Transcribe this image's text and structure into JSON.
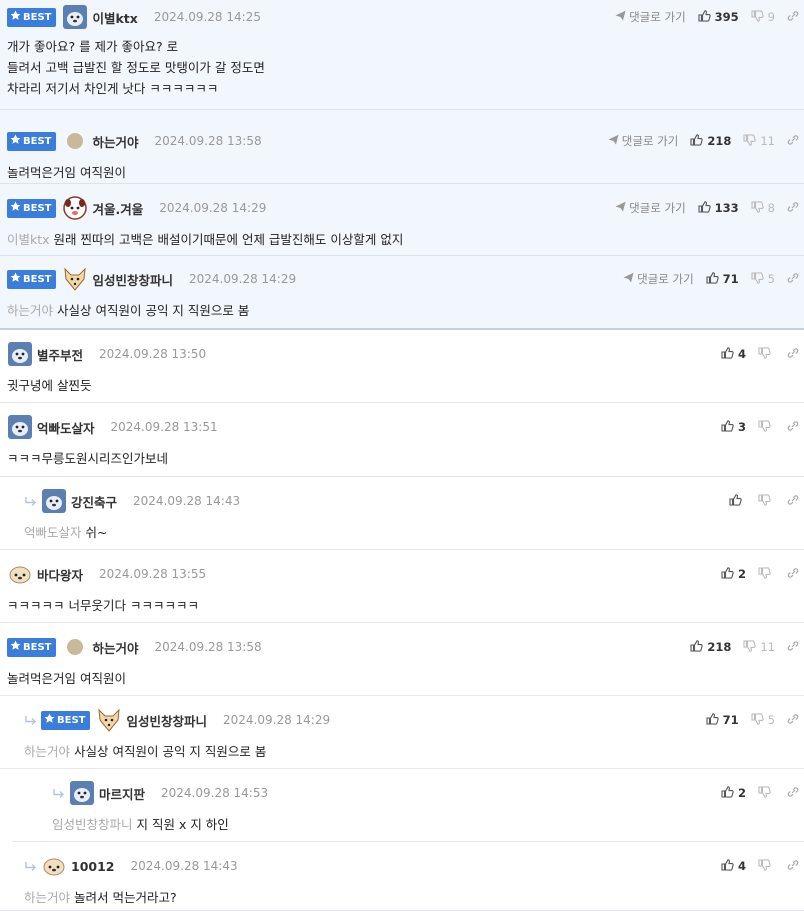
{
  "best_label": "BEST",
  "goto_label": "댓글로 가기",
  "comments": [
    {
      "nick": "이별ktx",
      "date": "2024.09.28 14:25",
      "up": "395",
      "down": "9",
      "best": true,
      "goto": true,
      "avatar": "dog-avatar",
      "lines": [
        "개가 좋아요? 를 제가 좋아요? 로",
        "들려서 고백 급발진 할 정도로 맛탱이가 갈 정도면",
        "차라리 저기서 차인게 낫다 ㅋㅋㅋㅋㅋㅋ"
      ],
      "mention": ""
    },
    {
      "nick": "하는거야",
      "date": "2024.09.28 13:58",
      "up": "218",
      "down": "11",
      "best": true,
      "goto": true,
      "avatar": "dot-avatar",
      "lines": [
        "놀려먹은거임 여직원이"
      ],
      "mention": ""
    },
    {
      "nick": "겨울.겨울",
      "date": "2024.09.28 14:29",
      "up": "133",
      "down": "8",
      "best": true,
      "goto": true,
      "avatar": "pig-avatar",
      "lines": [
        "원래 찐따의 고백은 배설이기때문에 언제 급발진해도 이상할게 없지"
      ],
      "mention": "이별ktx"
    },
    {
      "nick": "임성빈창창파니",
      "date": "2024.09.28 14:29",
      "up": "71",
      "down": "5",
      "best": true,
      "goto": true,
      "avatar": "fox-avatar",
      "lines": [
        "사실상 여직원이 공익 지 직원으로 봄"
      ],
      "mention": "하는거야"
    },
    {
      "nick": "별주부전",
      "date": "2024.09.28 13:50",
      "up": "4",
      "down": "",
      "best": false,
      "goto": false,
      "avatar": "dog-avatar",
      "lines": [
        "귓구녕에 살찐듯"
      ],
      "mention": ""
    },
    {
      "nick": "억빠도살자",
      "date": "2024.09.28 13:51",
      "up": "3",
      "down": "",
      "best": false,
      "goto": false,
      "avatar": "dog-avatar",
      "lines": [
        "ㅋㅋㅋ무릉도원시리즈인가보네"
      ],
      "mention": ""
    },
    {
      "nick": "강진축구",
      "date": "2024.09.28 14:43",
      "up": "",
      "down": "",
      "best": false,
      "goto": false,
      "avatar": "dog-avatar",
      "lines": [
        "쉬~"
      ],
      "mention": "억빠도살자"
    },
    {
      "nick": "바다왕자",
      "date": "2024.09.28 13:55",
      "up": "2",
      "down": "",
      "best": false,
      "goto": false,
      "avatar": "puppy-avatar",
      "lines": [
        "ㅋㅋㅋㅋㅋ 너무웃기다 ㅋㅋㅋㅋㅋㅋ"
      ],
      "mention": ""
    },
    {
      "nick": "하는거야",
      "date": "2024.09.28 13:58",
      "up": "218",
      "down": "11",
      "best": true,
      "goto": false,
      "avatar": "dot-avatar",
      "lines": [
        "놀려먹은거임 여직원이"
      ],
      "mention": ""
    },
    {
      "nick": "임성빈창창파니",
      "date": "2024.09.28 14:29",
      "up": "71",
      "down": "5",
      "best": true,
      "goto": false,
      "avatar": "fox-avatar",
      "lines": [
        "사실상 여직원이 공익 지 직원으로 봄"
      ],
      "mention": "하는거야"
    },
    {
      "nick": "마르지판",
      "date": "2024.09.28 14:53",
      "up": "2",
      "down": "",
      "best": false,
      "goto": false,
      "avatar": "dog-avatar",
      "lines": [
        "지 직원 x 지 하인"
      ],
      "mention": "임성빈창창파니"
    },
    {
      "nick": "10012",
      "date": "2024.09.28 14:43",
      "up": "4",
      "down": "",
      "best": false,
      "goto": false,
      "avatar": "puppy-avatar",
      "lines": [
        "놀려서 먹는거라고?"
      ],
      "mention": "하는거야"
    }
  ]
}
